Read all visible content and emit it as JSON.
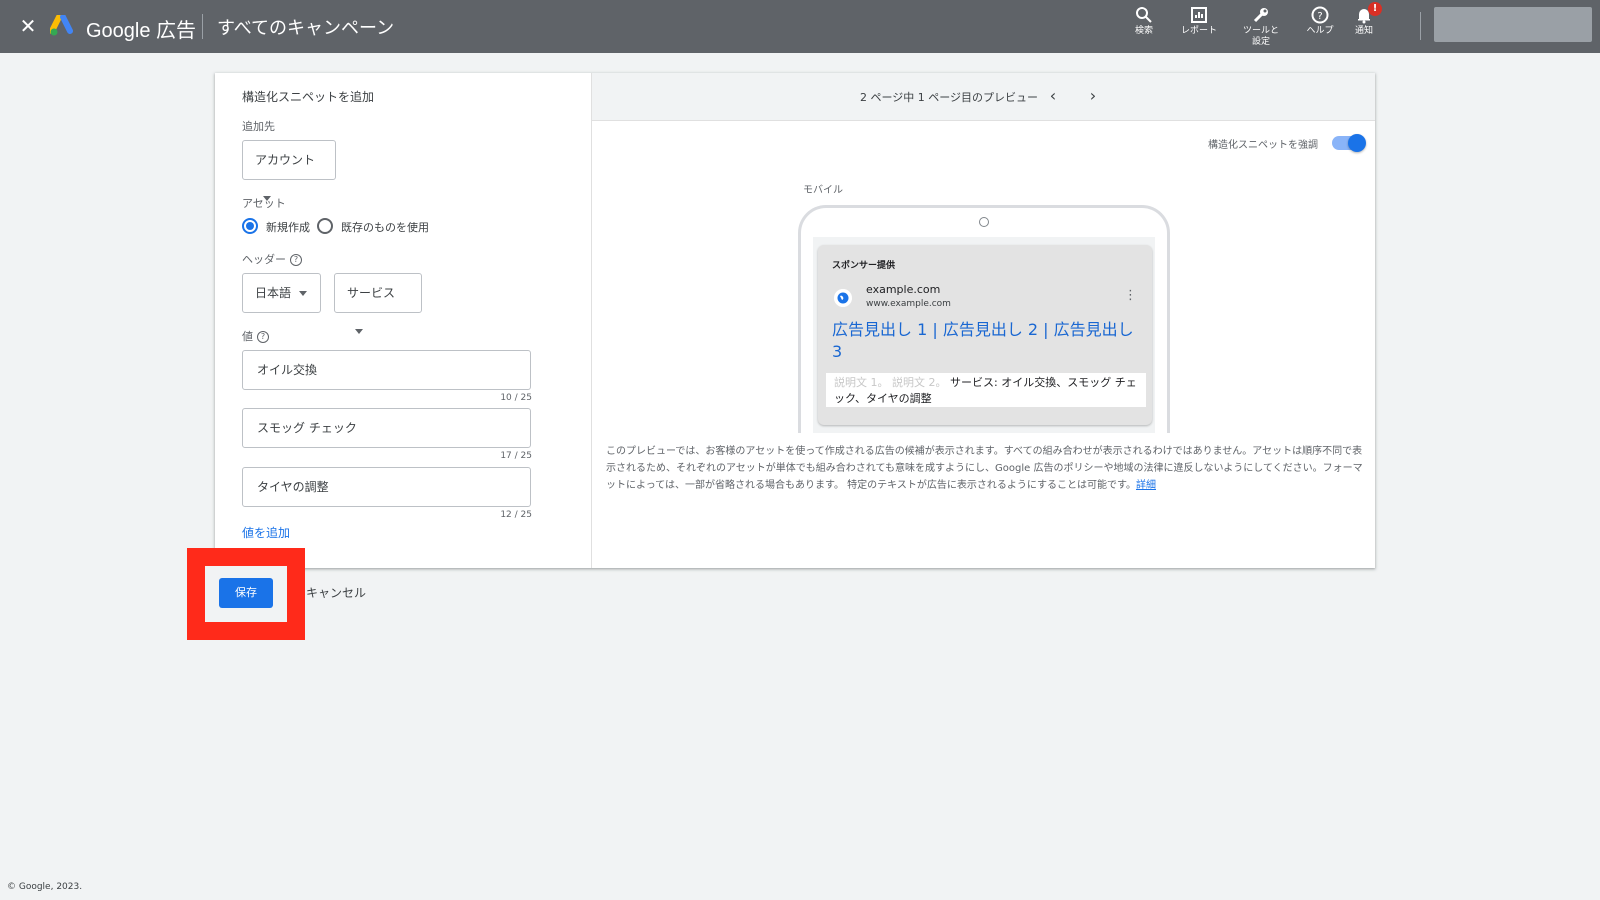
{
  "topbar": {
    "brand": "Google 広告",
    "breadcrumb": "すべてのキャンペーン",
    "tools": [
      {
        "label": "検索",
        "icon": "search-icon"
      },
      {
        "label": "レポート",
        "icon": "report-icon"
      },
      {
        "label": "ツールと\n設定",
        "icon": "wrench-icon"
      },
      {
        "label": "ヘルプ",
        "icon": "help-icon"
      },
      {
        "label": "通知",
        "icon": "bell-icon"
      }
    ],
    "notification_badge": "!"
  },
  "form": {
    "title": "構造化スニペットを追加",
    "add_to_label": "追加先",
    "add_to_value": "アカウント",
    "asset_label": "アセット",
    "radio_new": "新規作成",
    "radio_existing": "既存のものを使用",
    "header_label": "ヘッダー",
    "language_value": "日本語",
    "header_value": "サービス",
    "values_label": "値",
    "values": [
      {
        "text": "オイル交換",
        "counter": "10 / 25"
      },
      {
        "text": "スモッグ チェック",
        "counter": "17 / 25"
      },
      {
        "text": "タイヤの調整",
        "counter": "12 / 25"
      }
    ],
    "add_value_link": "値を追加"
  },
  "preview": {
    "page_info": "2 ページ中 1 ページ目のプレビュー",
    "emphasize_label": "構造化スニペットを強調",
    "emphasize_on": true,
    "mobile_label": "モバイル",
    "ad": {
      "sponsor": "スポンサー提供",
      "domain": "example.com",
      "url": "www.example.com",
      "headline": "広告見出し 1 | 広告見出し 2 | 広告見出し 3",
      "desc_placeholder": "説明文 1。 説明文 2。",
      "desc_snippet": "サービス: オイル交換、スモッグ チェック、タイヤの調整"
    },
    "disclaimer": "このプレビューでは、お客様のアセットを使って作成される広告の候補が表示されます。すべての組み合わせが表示されるわけではありません。アセットは順序不同で表示されるため、それぞれのアセットが単体でも組み合わされても意味を成すようにし、Google 広告のポリシーや地域の法律に違反しないようにしてください。フォーマットによっては、一部が省略される場合もあります。 特定のテキストが広告に表示されるようにすることは可能です。",
    "disclaimer_link": "詳細"
  },
  "actions": {
    "save": "保存",
    "cancel": "キャンセル"
  },
  "footer": "© Google, 2023.",
  "colors": {
    "topbar": "#5f6368",
    "accent": "#1a73e8",
    "highlight_box": "#ff2a1a"
  }
}
